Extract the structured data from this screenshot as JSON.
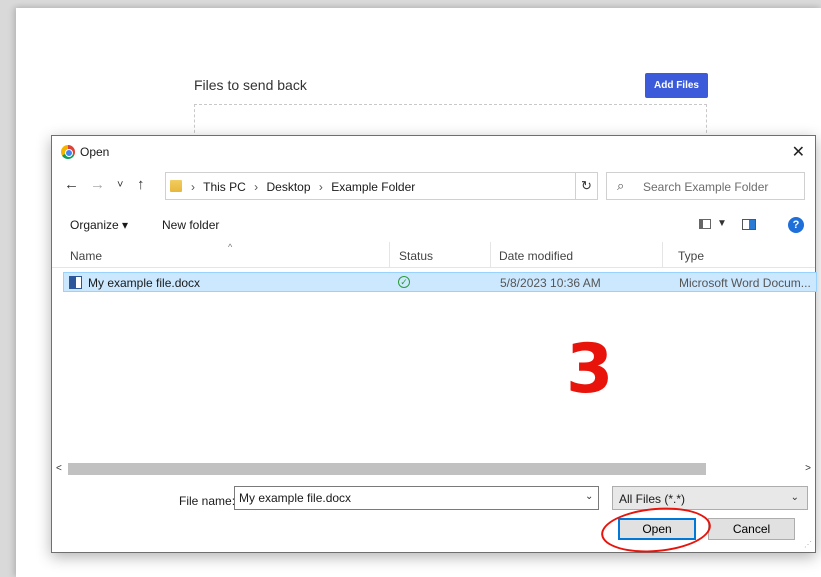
{
  "page": {
    "heading": "Files to send back",
    "add_files_label": "Add Files"
  },
  "dialog": {
    "title": "Open",
    "app_icon": "chrome-icon",
    "close_glyph": "✕",
    "nav": {
      "back_glyph": "←",
      "forward_glyph": "→",
      "recent_glyph": "˅",
      "up_glyph": "↑",
      "breadcrumb_sep": "›",
      "breadcrumbs": [
        "This PC",
        "Desktop",
        "Example Folder"
      ],
      "address_dropdown_glyph": "⌄",
      "refresh_glyph": "↻",
      "search_glyph": "⌕",
      "search_placeholder": "Search Example Folder"
    },
    "toolbar": {
      "organize_label": "Organize ▾",
      "new_folder_label": "New folder",
      "view_caret": "▼",
      "help_label": "?"
    },
    "columns": {
      "name": "Name",
      "status": "Status",
      "date_modified": "Date modified",
      "type": "Type",
      "sort_glyph": "^"
    },
    "files": [
      {
        "name": "My example file.docx",
        "status_icon": "synced-check-icon",
        "status_glyph": "✓",
        "date_modified": "5/8/2023 10:36 AM",
        "type": "Microsoft Word Docum..."
      }
    ],
    "annotation_step": "3",
    "scroll": {
      "left_glyph": "<",
      "right_glyph": ">"
    },
    "bottom": {
      "file_name_label": "File name:",
      "file_name_value": "My example file.docx",
      "file_name_caret": "⌄",
      "file_type_value": "All Files (*.*)",
      "file_type_caret": "⌄",
      "open_label": "Open",
      "cancel_label": "Cancel"
    },
    "colors": {
      "selection": "#cce8ff",
      "accent": "#0078d7",
      "annotation": "#e8130b",
      "add_files_bg": "#3b5bdb"
    }
  }
}
